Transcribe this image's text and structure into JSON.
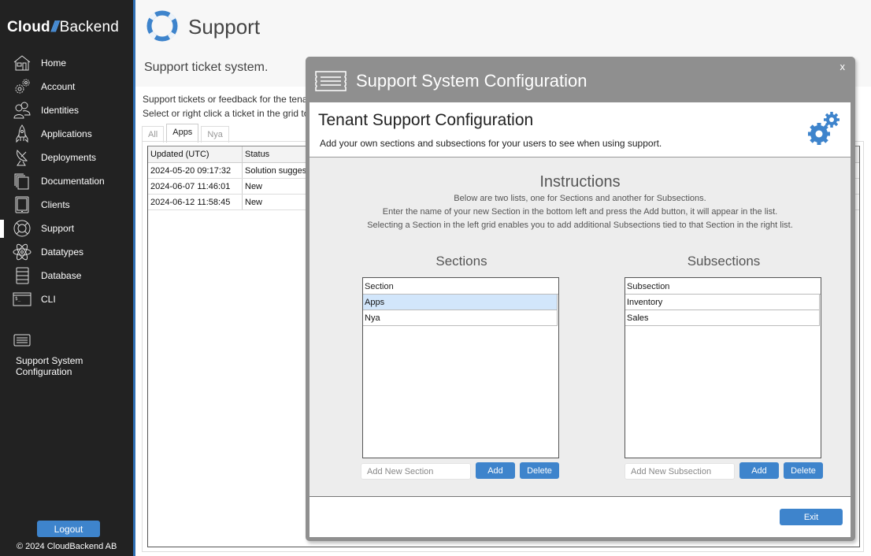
{
  "brand": {
    "name_bold": "Cloud",
    "slashes": "///",
    "name_light": "Backend",
    "accent_color": "#3e84cc"
  },
  "sidebar": {
    "items": [
      {
        "label": "Home",
        "icon": "home-icon",
        "active": false
      },
      {
        "label": "Account",
        "icon": "gears-icon",
        "active": false
      },
      {
        "label": "Identities",
        "icon": "users-icon",
        "active": false
      },
      {
        "label": "Applications",
        "icon": "rocket-icon",
        "active": false
      },
      {
        "label": "Deployments",
        "icon": "satellite-dish-icon",
        "active": false
      },
      {
        "label": "Documentation",
        "icon": "documents-icon",
        "active": false
      },
      {
        "label": "Clients",
        "icon": "tablet-icon",
        "active": false
      },
      {
        "label": "Support",
        "icon": "lifebuoy-icon",
        "active": true
      },
      {
        "label": "Datatypes",
        "icon": "atom-icon",
        "active": false
      },
      {
        "label": "Database",
        "icon": "database-icon",
        "active": false
      },
      {
        "label": "CLI",
        "icon": "terminal-icon",
        "active": false
      }
    ],
    "config_link": {
      "label": "Support System Configuration",
      "icon": "list-icon"
    },
    "logout_label": "Logout",
    "copyright": "© 2024 CloudBackend AB"
  },
  "page": {
    "title": "Support",
    "subtitle": "Support ticket system.",
    "desc1": "Support tickets or feedback for the tenant are shown",
    "desc2": "Select or right click a ticket in the grid to",
    "tabs": [
      {
        "label": "All",
        "active": false
      },
      {
        "label": "Apps",
        "active": true
      },
      {
        "label": "Nya",
        "active": false
      }
    ],
    "grid": {
      "columns": [
        "Updated (UTC)",
        "Status"
      ],
      "rows": [
        [
          "2024-05-20 09:17:32",
          "Solution suggested"
        ],
        [
          "2024-06-07 11:46:01",
          "New"
        ],
        [
          "2024-06-12 11:58:45",
          "New"
        ]
      ]
    }
  },
  "modal": {
    "title": "Support System Configuration",
    "close_label": "x",
    "header_title": "Tenant Support Configuration",
    "header_subtitle": "Add your own sections and subsections for your users to see when using support.",
    "instructions_title": "Instructions",
    "instructions": [
      "Below are two lists, one for Sections and another for Subsections.",
      "Enter the name of your new Section in the bottom left and press the Add button, it will appear in the list.",
      "Selecting a Section in the left grid enables you to add additional Subsections tied to that Section in the right list."
    ],
    "sections": {
      "title": "Sections",
      "column": "Section",
      "rows": [
        "Apps",
        "Nya"
      ],
      "selected": "Apps",
      "input_placeholder": "Add New Section",
      "input_value": "",
      "add_label": "Add",
      "delete_label": "Delete"
    },
    "subsections": {
      "title": "Subsections",
      "column": "Subsection",
      "rows": [
        "Inventory",
        "Sales"
      ],
      "input_placeholder": "Add New Subsection",
      "input_value": "",
      "add_label": "Add",
      "delete_label": "Delete"
    },
    "exit_label": "Exit"
  }
}
